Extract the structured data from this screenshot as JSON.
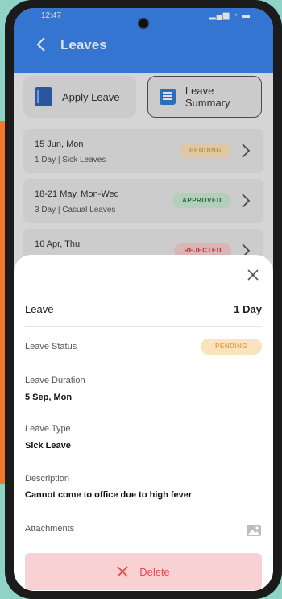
{
  "status": {
    "time": "12:47",
    "icons": "▂▄▆ ◔ ▬"
  },
  "header": {
    "title": "Leaves"
  },
  "buttons": {
    "apply_label": "Apply Leave",
    "summary_label": "Leave Summary"
  },
  "leaves": [
    {
      "date": "15 Jun, Mon",
      "sub": "1 Day | Sick Leaves",
      "status": "PENDING"
    },
    {
      "date": "18-21 May, Mon-Wed",
      "sub": "3 Day | Casual Leaves",
      "status": "APPROVED"
    },
    {
      "date": "16 Apr, Thu",
      "sub": "",
      "status": "REJECTED"
    }
  ],
  "sheet": {
    "title": "Leave",
    "duration": "1 Day",
    "status_label": "Leave Status",
    "status_value": "PENDING",
    "duration_label": "Leave Duration",
    "duration_value": "5 Sep, Mon",
    "type_label": "Leave Type",
    "type_value": "Sick Leave",
    "desc_label": "Description",
    "desc_value": "Cannot come to office due to high fever",
    "attach_label": "Attachments",
    "delete_label": "Delete"
  },
  "colors": {
    "header": "#3b86ee",
    "pending": "#e2a34a",
    "approved": "#2e7b4c",
    "rejected": "#d23c3c",
    "delete": "#e5484d"
  }
}
